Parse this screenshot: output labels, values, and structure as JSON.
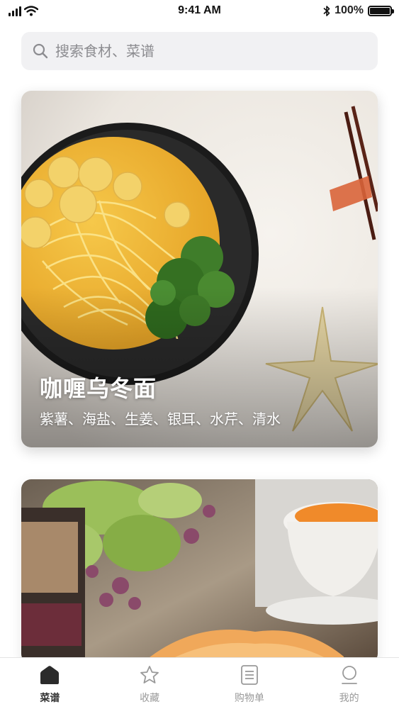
{
  "status_bar": {
    "time": "9:41 AM",
    "battery": "100%",
    "battery_level": 1.0
  },
  "search": {
    "placeholder": "搜索食材、菜谱",
    "icon": "search-icon"
  },
  "recipes": [
    {
      "title": "咖喱乌冬面",
      "ingredients": "紫薯、海盐、生姜、银耳、水芹、清水"
    },
    {
      "title": "",
      "ingredients": ""
    }
  ],
  "tabbar": {
    "tabs": [
      {
        "label": "菜谱",
        "icon": "home-icon",
        "active": true
      },
      {
        "label": "收藏",
        "icon": "star-icon",
        "active": false
      },
      {
        "label": "购物单",
        "icon": "list-icon",
        "active": false
      },
      {
        "label": "我的",
        "icon": "user-icon",
        "active": false
      }
    ]
  },
  "colors": {
    "accent_active": "#333333",
    "inactive": "#9a9a9a",
    "search_bg": "#f1f1f3"
  }
}
